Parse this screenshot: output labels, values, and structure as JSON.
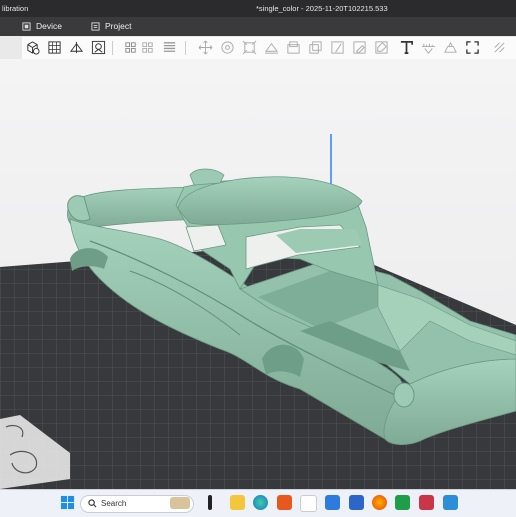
{
  "window": {
    "title_left": "libration",
    "title_center": "*single_color - 2025-11-20T102215.533"
  },
  "tabs": [
    {
      "label": "Device",
      "icon": "device-icon"
    },
    {
      "label": "Project",
      "icon": "project-icon"
    }
  ],
  "toolbar": {
    "tools": [
      "add-object-icon",
      "arrange-grid-icon",
      "orient-icon",
      "auto-arrange-icon",
      "split-icon",
      "layers-icon",
      "list-icon",
      "move-icon",
      "rotate-icon",
      "scale-icon",
      "lay-on-face-icon",
      "cut-icon",
      "boolean-icon",
      "support-paint-icon",
      "seam-paint-icon",
      "color-paint-icon",
      "text-icon",
      "measure-icon",
      "assembly-icon",
      "fullscreen-icon"
    ]
  },
  "taskbar": {
    "search_placeholder": "Search",
    "apps": [
      "start-icon",
      "search-icon",
      "widgets-icon",
      "task-view-icon",
      "file-explorer-icon",
      "edge-icon",
      "app-f-icon",
      "app-cat-icon",
      "app-blue-icon",
      "mail-icon",
      "firefox-icon",
      "excel-icon",
      "app-red-icon",
      "app-blue2-icon"
    ]
  },
  "colors": {
    "model": "#8dbba5",
    "plate": "#3b3d40",
    "grid": "#5a5d61",
    "accent": "#1f77ff"
  }
}
